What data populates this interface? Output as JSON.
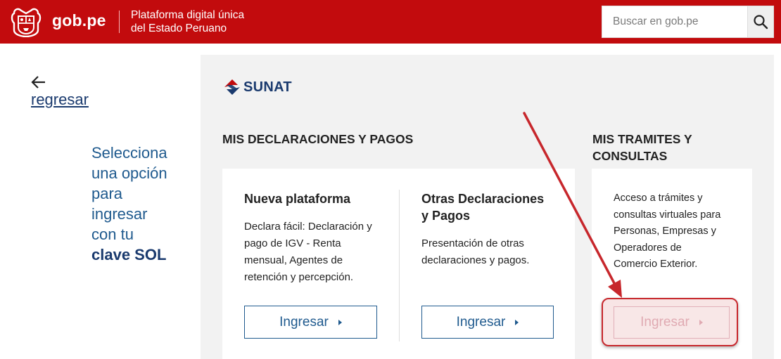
{
  "header": {
    "brand": "gob.pe",
    "tagline_line1": "Plataforma digital única",
    "tagline_line2": "del Estado Peruano",
    "search_placeholder": "Buscar en gob.pe",
    "colors": {
      "bar": "#c20b0d"
    }
  },
  "nav": {
    "back_label": "regresar"
  },
  "left": {
    "prompt_line1": "Selecciona",
    "prompt_line2": "una opción",
    "prompt_line3": "para",
    "prompt_line4": "ingresar",
    "prompt_line5": "con tu",
    "prompt_bold": "clave SOL"
  },
  "logo": {
    "text": "SUNAT"
  },
  "sections": {
    "declaraciones_title": "MIS DECLARACIONES Y PAGOS",
    "tramites_title_line1": "MIS TRAMITES Y",
    "tramites_title_line2": "CONSULTAS"
  },
  "cards": {
    "nueva": {
      "title": "Nueva plataforma",
      "desc_line1": "Declara fácil: Declaración y",
      "desc_line2": "pago de IGV - Renta",
      "desc_line3": "mensual, Agentes de",
      "desc_line4": "retención y percepción.",
      "button": "Ingresar"
    },
    "otras": {
      "title_line1": "Otras Declaraciones",
      "title_line2": "y Pagos",
      "desc_line1": "Presentación de otras",
      "desc_line2": "declaraciones y pagos.",
      "button": "Ingresar"
    },
    "tramites": {
      "desc_line1": "Acceso a trámites y",
      "desc_line2": "consultas virtuales para",
      "desc_line3": "Personas, Empresas y",
      "desc_line4": "Operadores de",
      "desc_line5": "Comercio Exterior.",
      "button": "Ingresar"
    }
  },
  "icons": {
    "shield": "peru-shield-icon",
    "search": "search-icon",
    "back": "arrow-left-icon",
    "sunat": "sunat-logo-icon",
    "caret": "caret-right-icon"
  },
  "colors": {
    "accent": "#1f5a8e",
    "dark_blue": "#1a3a6e",
    "annotation": "#c7272c"
  }
}
